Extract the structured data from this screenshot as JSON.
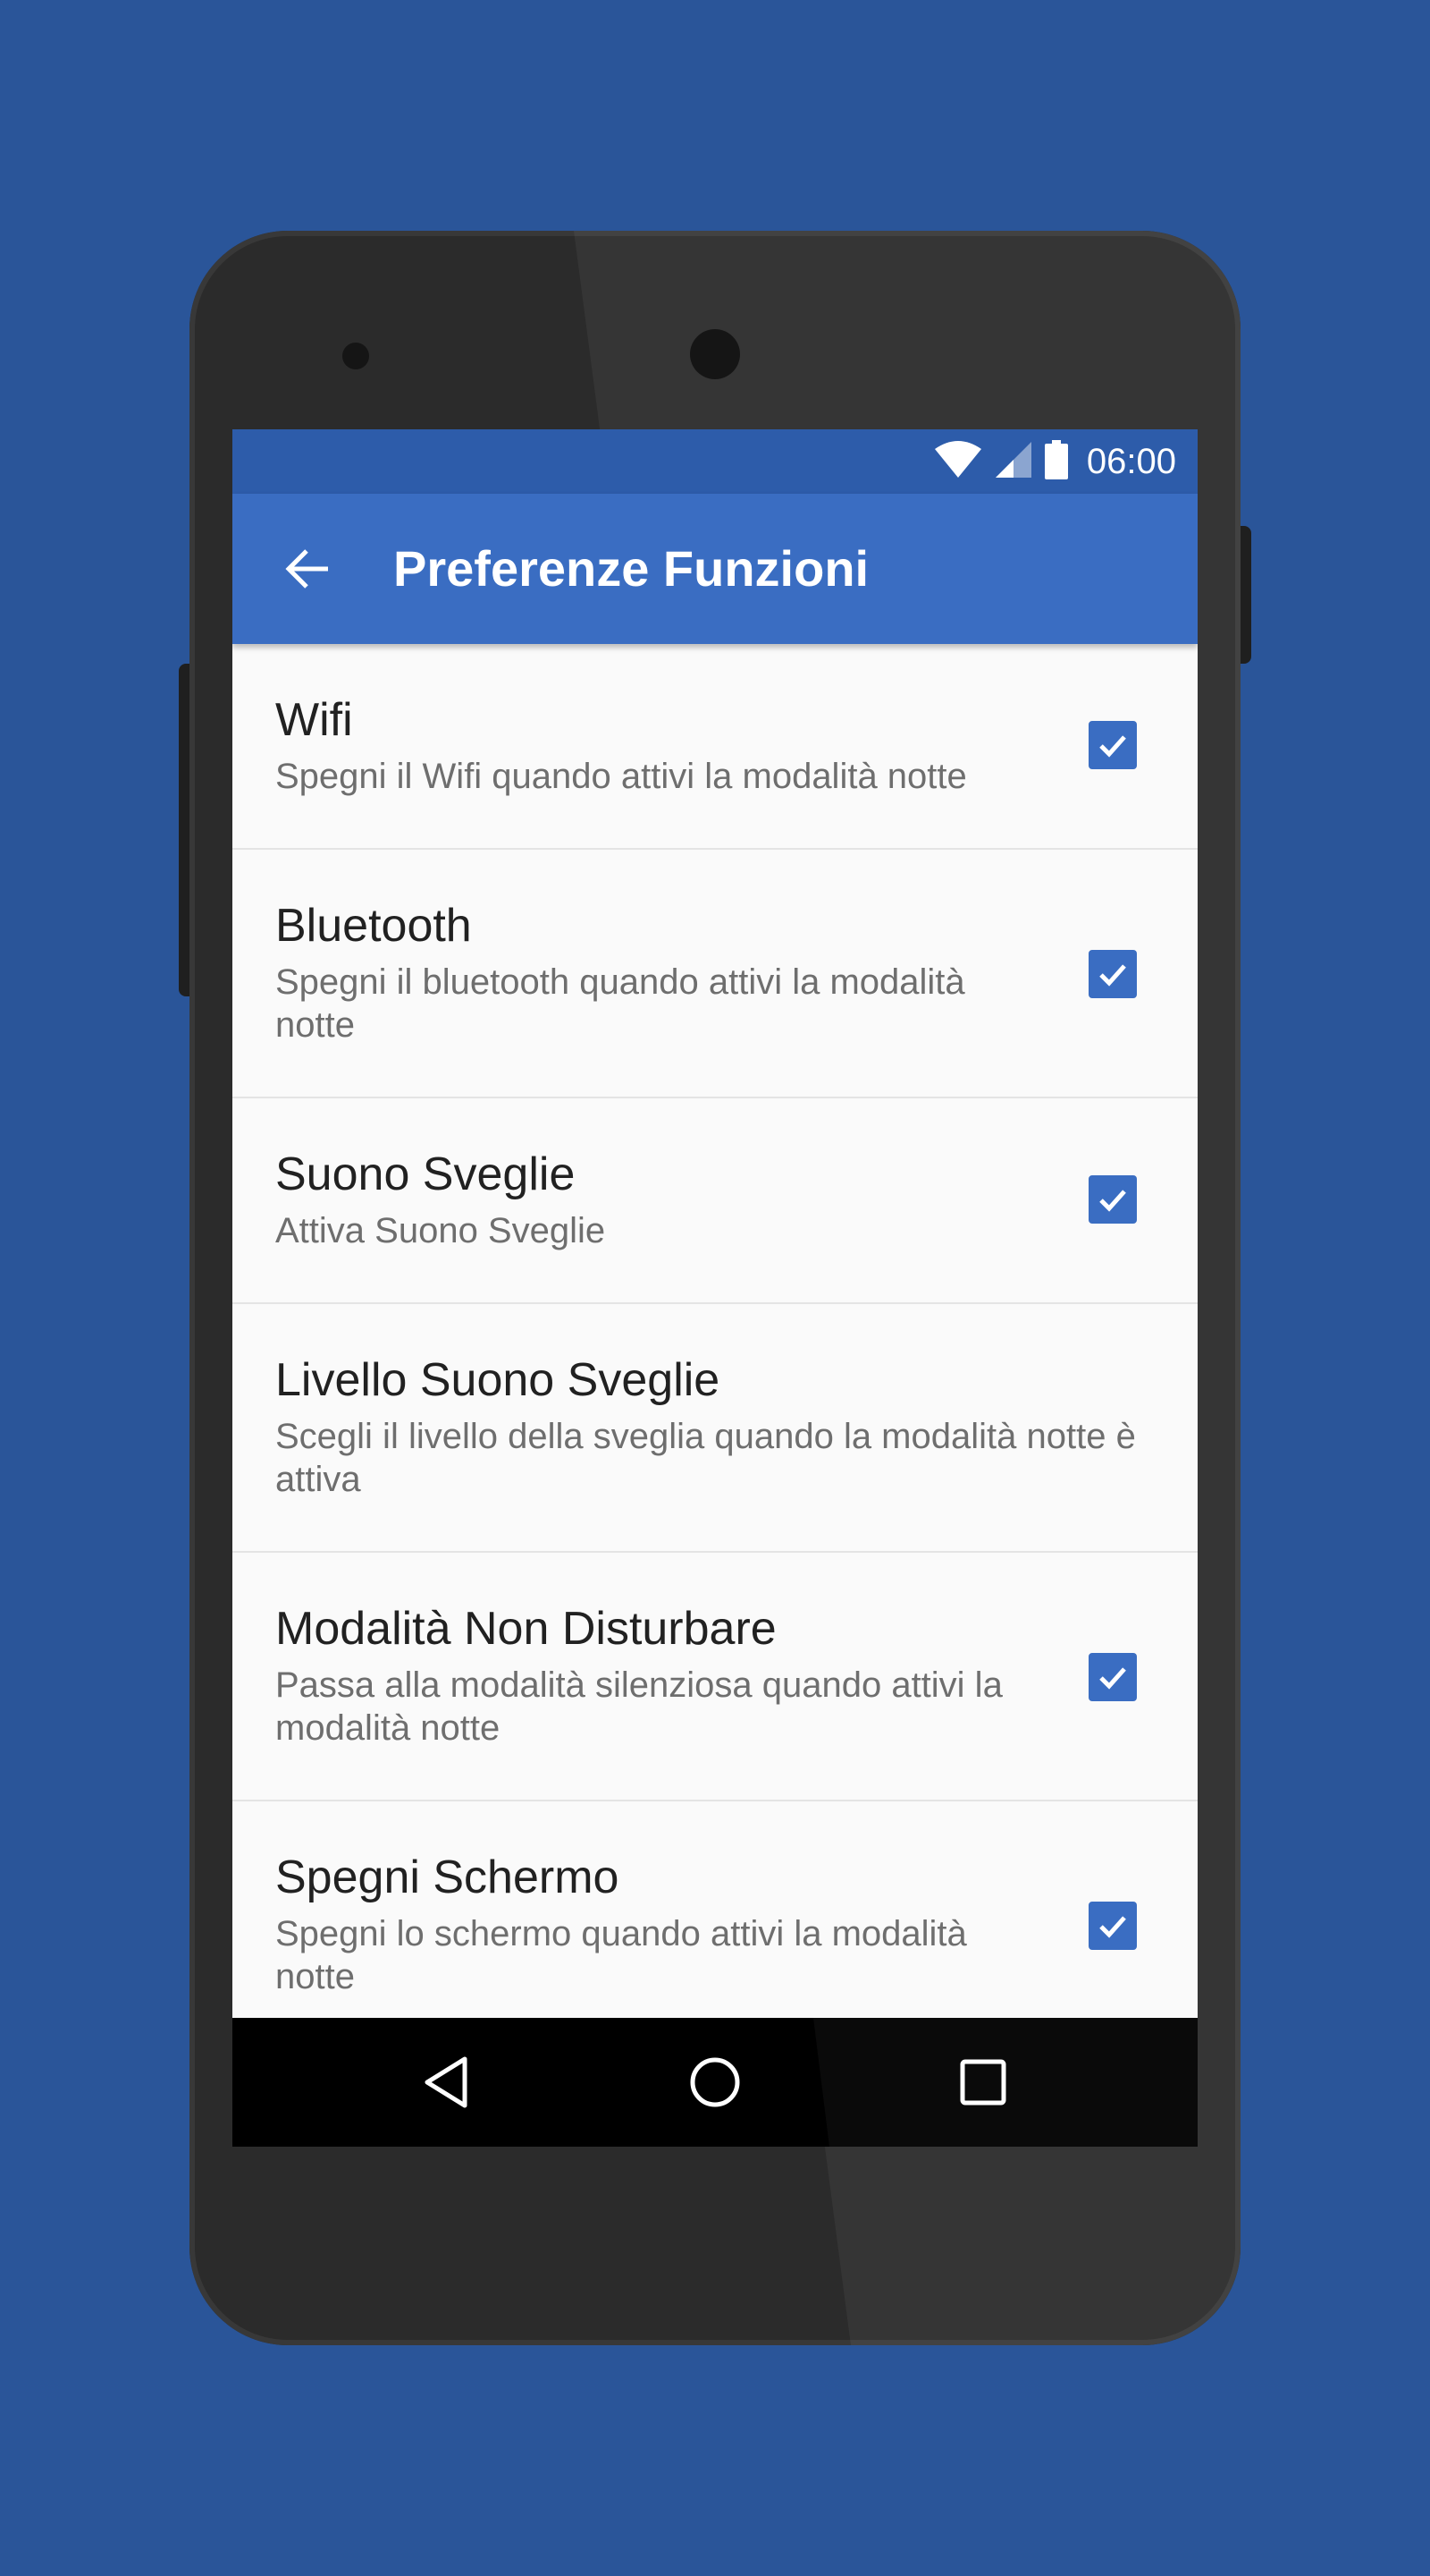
{
  "status_bar": {
    "time": "06:00",
    "icons": [
      "wifi-icon",
      "signal-icon",
      "battery-icon"
    ]
  },
  "app_bar": {
    "back_icon": "arrow-back-icon",
    "title": "Preferenze Funzioni"
  },
  "preferences": [
    {
      "title": "Wifi",
      "summary": "Spegni il Wifi quando attivi la modalità notte",
      "checked": true
    },
    {
      "title": "Bluetooth",
      "summary": "Spegni il bluetooth quando attivi la modalità notte",
      "checked": true
    },
    {
      "title": "Suono Sveglie",
      "summary": "Attiva Suono Sveglie",
      "checked": true
    },
    {
      "title": "Livello Suono Sveglie",
      "summary": "Scegli il livello della sveglia quando la modalità notte è attiva",
      "checked": null
    },
    {
      "title": "Modalità Non Disturbare",
      "summary": "Passa alla modalità silenziosa quando attivi la modalità notte",
      "checked": true
    },
    {
      "title": "Spegni Schermo",
      "summary": "Spegni lo schermo quando attivi la modalità notte",
      "checked": true
    }
  ],
  "nav_bar": {
    "buttons": [
      "back-triangle-icon",
      "home-circle-icon",
      "recents-square-icon"
    ]
  },
  "colors": {
    "background": "#2a5599",
    "status_bar": "#2d5caa",
    "app_bar": "#3a6dc2",
    "accent": "#3a6dc2"
  }
}
